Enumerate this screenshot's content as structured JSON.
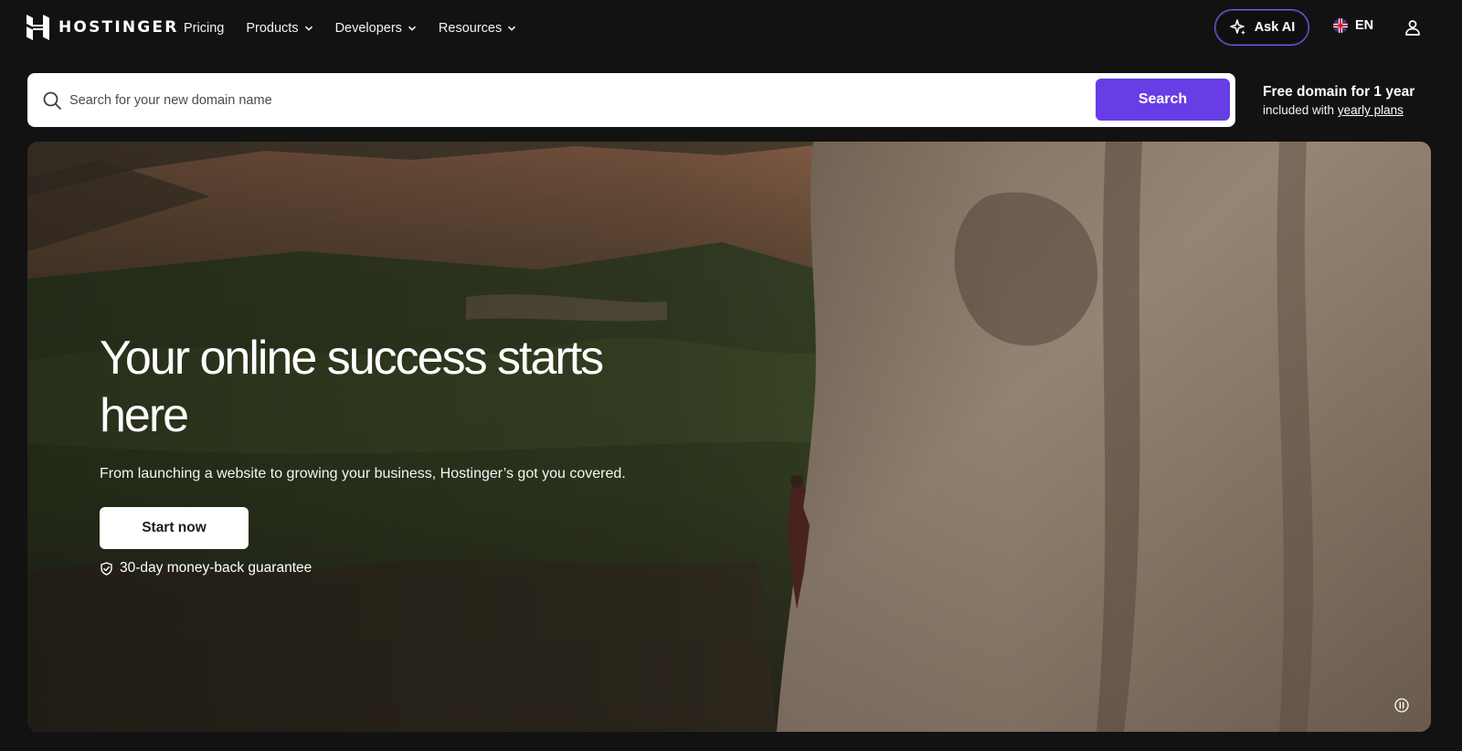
{
  "header": {
    "brand": "HOSTINGER",
    "nav": [
      {
        "label": "Pricing",
        "has_dropdown": false
      },
      {
        "label": "Products",
        "has_dropdown": true
      },
      {
        "label": "Developers",
        "has_dropdown": true
      },
      {
        "label": "Resources",
        "has_dropdown": true
      }
    ],
    "ask_ai_label": "Ask AI",
    "language": "EN",
    "icons": [
      "hostinger-logo-icon",
      "chevron-down-icon",
      "sparkle-icon",
      "uk-flag-icon",
      "user-icon"
    ]
  },
  "domain_search": {
    "placeholder": "Search for your new domain name",
    "value": "",
    "button_label": "Search",
    "promo_title": "Free domain for 1 year",
    "promo_text": "included with",
    "promo_link": "yearly plans"
  },
  "hero": {
    "title": "Your online success starts here",
    "subtitle": "From launching a website to growing your business, Hostinger’s got you covered.",
    "cta_label": "Start now",
    "guarantee_text": "30-day money-back guarantee"
  },
  "colors": {
    "background": "#121212",
    "accent": "#673de6",
    "search_bg": "#ffffff",
    "text": "#ffffff"
  }
}
